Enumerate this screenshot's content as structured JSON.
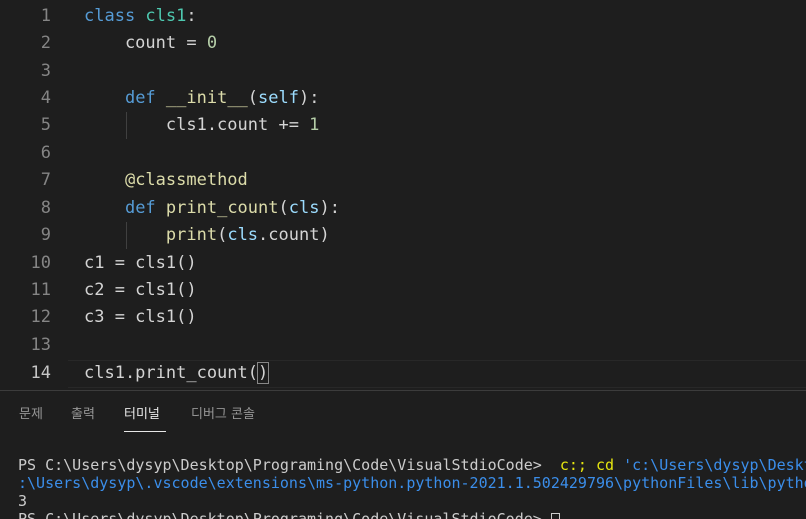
{
  "editor": {
    "line_numbers": [
      "1",
      "2",
      "3",
      "4",
      "5",
      "6",
      "7",
      "8",
      "9",
      "10",
      "11",
      "12",
      "13",
      "14"
    ],
    "lines": [
      [
        {
          "t": "class ",
          "c": "kw"
        },
        {
          "t": "cls1",
          "c": "cls"
        },
        {
          "t": ":",
          "c": "plain"
        }
      ],
      [
        {
          "t": "    count = ",
          "c": "plain"
        },
        {
          "t": "0",
          "c": "num"
        }
      ],
      [],
      [
        {
          "t": "    ",
          "c": "plain"
        },
        {
          "t": "def ",
          "c": "kw"
        },
        {
          "t": "__init__",
          "c": "fn"
        },
        {
          "t": "(",
          "c": "plain"
        },
        {
          "t": "self",
          "c": "param"
        },
        {
          "t": "):",
          "c": "plain"
        }
      ],
      [
        {
          "t": "        cls1.count += ",
          "c": "plain"
        },
        {
          "t": "1",
          "c": "num"
        }
      ],
      [],
      [
        {
          "t": "    ",
          "c": "plain"
        },
        {
          "t": "@classmethod",
          "c": "dec"
        }
      ],
      [
        {
          "t": "    ",
          "c": "plain"
        },
        {
          "t": "def ",
          "c": "kw"
        },
        {
          "t": "print_count",
          "c": "fn"
        },
        {
          "t": "(",
          "c": "plain"
        },
        {
          "t": "cls",
          "c": "param"
        },
        {
          "t": "):",
          "c": "plain"
        }
      ],
      [
        {
          "t": "        ",
          "c": "plain"
        },
        {
          "t": "print",
          "c": "fn"
        },
        {
          "t": "(",
          "c": "plain"
        },
        {
          "t": "cls",
          "c": "param"
        },
        {
          "t": ".count)",
          "c": "plain"
        }
      ],
      [
        {
          "t": "c1 = cls1()",
          "c": "plain"
        }
      ],
      [
        {
          "t": "c2 = cls1()",
          "c": "plain"
        }
      ],
      [
        {
          "t": "c3 = cls1()",
          "c": "plain"
        }
      ],
      [],
      [
        {
          "t": "cls1.print_count(",
          "c": "plain"
        },
        {
          "t": ")",
          "c": "plain bracket"
        }
      ]
    ]
  },
  "panel": {
    "tabs": {
      "problems": "문제",
      "output": "출력",
      "terminal": "터미널",
      "debug_console": "디버그 콘솔"
    },
    "active_tab": "terminal",
    "terminal": {
      "line1_prompt": "PS C:\\Users\\dysyp\\Desktop\\Programing\\Code\\VisualStdioCode> ",
      "line1_cmd": " c:; cd ",
      "line1_path": "'c:\\Users\\dysyp\\Desktop\\Programi",
      "line2": ":\\Users\\dysyp\\.vscode\\extensions\\ms-python.python-2021.1.502429796\\pythonFiles\\lib\\python\\debugpy\\",
      "line3": "3",
      "line4": "PS C:\\Users\\dysyp\\Desktop\\Programing\\Code\\VisualStdioCode> "
    }
  }
}
